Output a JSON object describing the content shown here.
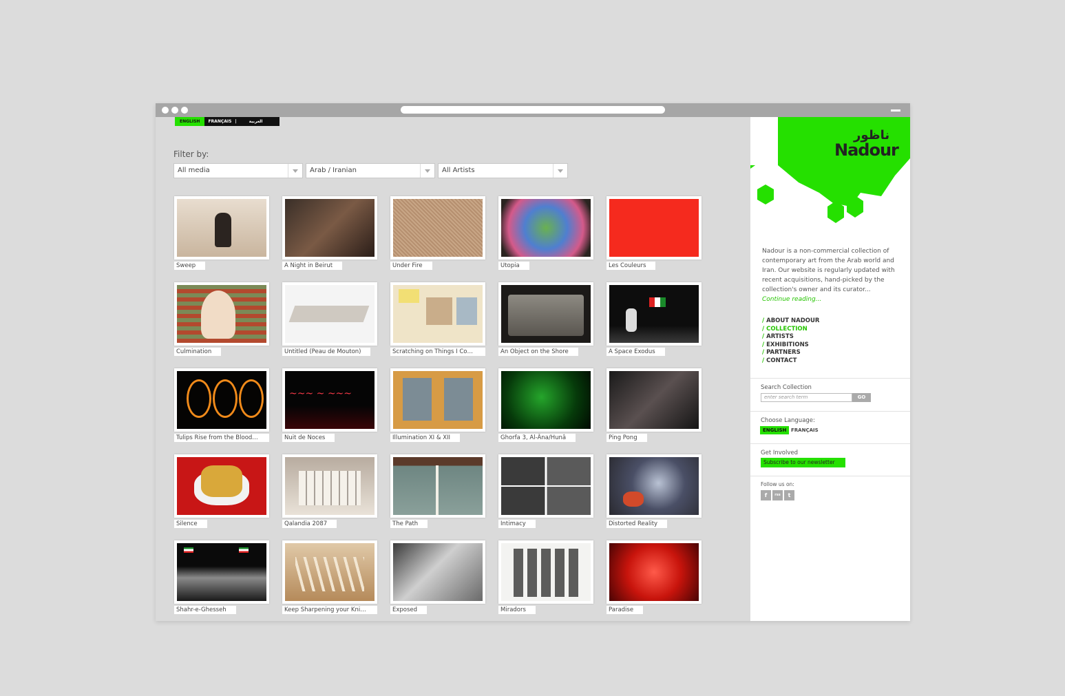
{
  "languages": {
    "english": "ENGLISH",
    "french": "FRANÇAIS",
    "sep": "|",
    "arabic": "العربية"
  },
  "filter": {
    "title": "Filter by:",
    "media": "All media",
    "region": "Arab / Iranian",
    "artists": "All Artists"
  },
  "artworks": [
    {
      "title": "Sweep"
    },
    {
      "title": "A Night in Beirut"
    },
    {
      "title": "Under Fire"
    },
    {
      "title": "Utopia"
    },
    {
      "title": "Les Couleurs"
    },
    {
      "title": "Culmination"
    },
    {
      "title": "Untitled (Peau de Mouton)"
    },
    {
      "title": "Scratching on Things I Could Di..."
    },
    {
      "title": "An Object on the Shore"
    },
    {
      "title": "A Space Exodus"
    },
    {
      "title": "Tulips Rise from the Blood of t..."
    },
    {
      "title": "Nuit de Noces"
    },
    {
      "title": "Illumination XI & XII"
    },
    {
      "title": "Ghorfa 3, Al-Âna/Hunâ"
    },
    {
      "title": "Ping Pong"
    },
    {
      "title": "Silence"
    },
    {
      "title": "Qalandia 2087"
    },
    {
      "title": "The Path"
    },
    {
      "title": "Intimacy"
    },
    {
      "title": "Distorted Reality"
    },
    {
      "title": "Shahr-e-Ghesseh"
    },
    {
      "title": "Keep Sharpening your Knife an..."
    },
    {
      "title": "Exposed"
    },
    {
      "title": "Miradors"
    },
    {
      "title": "Paradise"
    }
  ],
  "sidebar": {
    "logo_arabic": "ناظور",
    "logo_latin": "Nadour",
    "about": "Nadour is a non-commercial collection of contemporary art from the Arab world and Iran. Our website is regularly updated with recent acquisitions, hand-picked by the collection's owner and its curator...",
    "continue": "Continue reading...",
    "nav": {
      "about": "ABOUT NADOUR",
      "collection": "COLLECTION",
      "artists": "ARTISTS",
      "exhibitions": "EXHIBITIONS",
      "partners": "PARTNERS",
      "contact": "CONTACT"
    },
    "search_label": "Search Collection",
    "search_placeholder": "enter search term",
    "search_go": "GO",
    "choose_language": "Choose Language:",
    "lang_english": "ENGLISH",
    "lang_french": "FRANÇAIS",
    "get_involved": "Get Involved",
    "newsletter": "Subscribe to our newsletter",
    "follow": "Follow us on:",
    "social": [
      "f",
      "rss",
      "t"
    ]
  },
  "colors": {
    "accent": "#25e000",
    "background": "#dadada"
  }
}
